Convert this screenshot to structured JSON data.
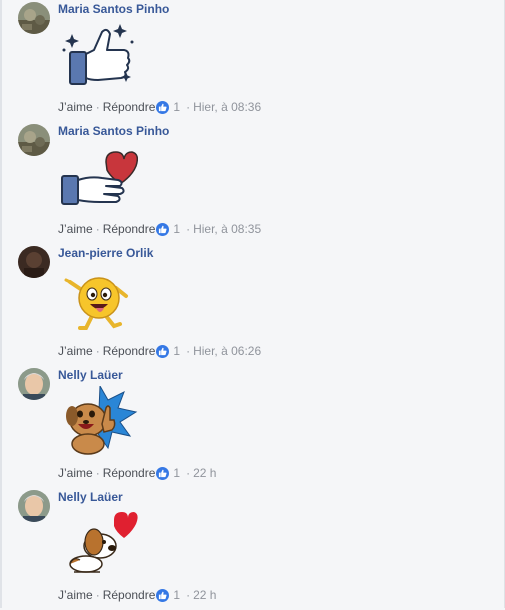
{
  "comments": [
    {
      "author": "Maria Santos Pinho",
      "like_label": "J’aime",
      "reply_label": "Répondre",
      "separator": "·",
      "reactions": "1",
      "time": "Hier, à 08:36",
      "sticker": "thumbs-up-sparkle-icon",
      "avatar": "landscape-avatar"
    },
    {
      "author": "Maria Santos Pinho",
      "like_label": "J’aime",
      "reply_label": "Répondre",
      "separator": "·",
      "reactions": "1",
      "time": "Hier, à 08:35",
      "sticker": "hand-heart-icon",
      "avatar": "landscape-avatar"
    },
    {
      "author": "Jean-pierre Orlik",
      "like_label": "J’aime",
      "reply_label": "Répondre",
      "separator": "·",
      "reactions": "1",
      "time": "Hier, à 06:26",
      "sticker": "dancing-emoji-icon",
      "avatar": "dark-avatar"
    },
    {
      "author": "Nelly Laüer",
      "like_label": "J’aime",
      "reply_label": "Répondre",
      "separator": "·",
      "reactions": "1",
      "time": "22 h",
      "sticker": "dog-thumbs-up-icon",
      "avatar": "portrait-avatar"
    },
    {
      "author": "Nelly Laüer",
      "like_label": "J’aime",
      "reply_label": "Répondre",
      "separator": "·",
      "reactions": "1",
      "time": "22 h",
      "sticker": "dog-heart-icon",
      "avatar": "portrait-avatar"
    }
  ],
  "colors": {
    "author": "#385898",
    "like_badge": "#3578e5",
    "meta": "#90949c",
    "background": "#f5f6f8"
  }
}
